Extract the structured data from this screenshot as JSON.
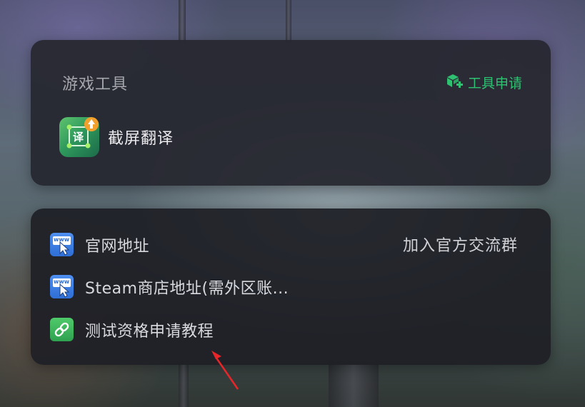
{
  "tools_panel": {
    "title": "游戏工具",
    "apply_label": "工具申请",
    "apply_icon": "box-plus-icon",
    "items": [
      {
        "label": "截屏翻译",
        "icon": "screenshot-translate-icon",
        "icon_glyph": "译"
      }
    ]
  },
  "links_panel": {
    "group_link": "加入官方交流群",
    "items": [
      {
        "label": "官网地址",
        "icon": "www-icon",
        "icon_text": "www"
      },
      {
        "label": "Steam商店地址(需外区账...",
        "icon": "www-icon",
        "icon_text": "www"
      },
      {
        "label": "测试资格申请教程",
        "icon": "link-chain-icon"
      }
    ]
  },
  "colors": {
    "accent_green": "#30c072",
    "panel_bg": "#25262e",
    "annotation_arrow": "#e8262a"
  }
}
